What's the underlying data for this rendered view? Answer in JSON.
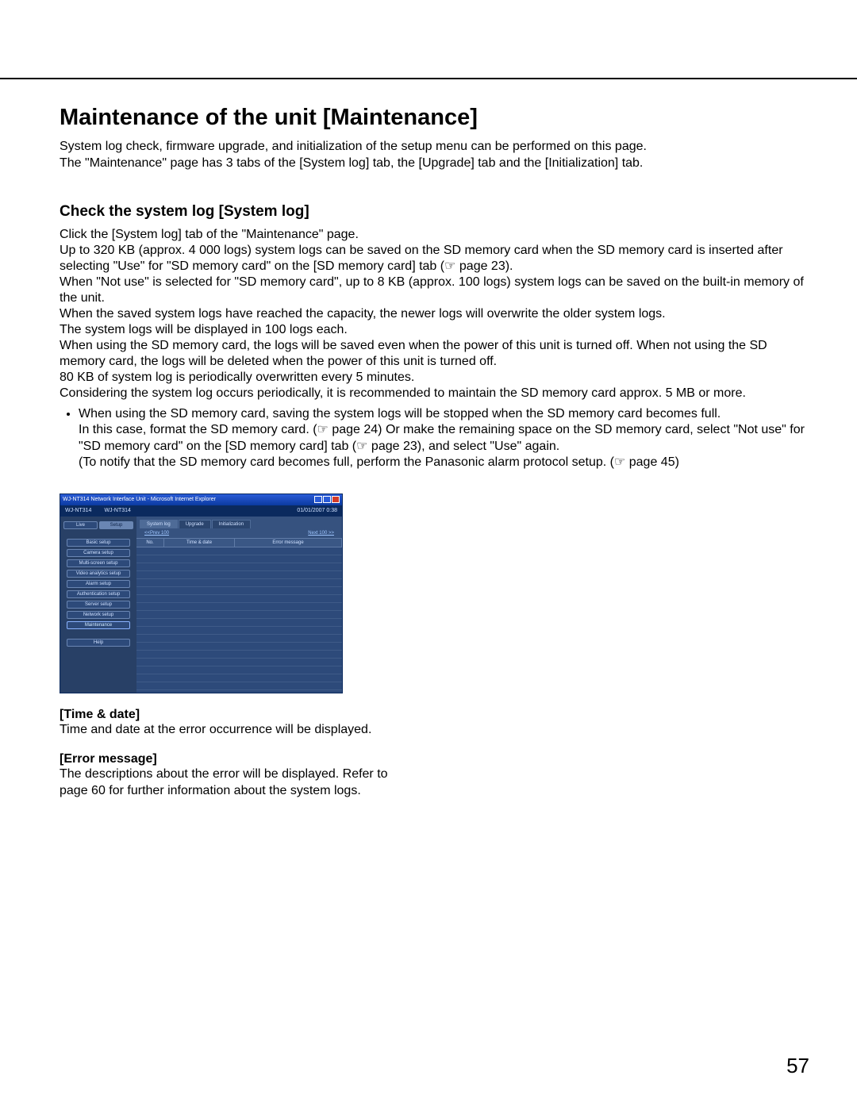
{
  "page_number": "57",
  "h1": "Maintenance of the unit [Maintenance]",
  "intro_1": "System log check, firmware upgrade, and initialization of the setup menu can be performed on this page.",
  "intro_2": "The \"Maintenance\" page has 3 tabs of the [System log] tab, the [Upgrade] tab and the [Initialization] tab.",
  "h2": "Check the system log [System log]",
  "body": {
    "p1": "Click the [System log] tab of the \"Maintenance\" page.",
    "p2": "Up to 320 KB (approx. 4 000 logs) system logs can be saved on the SD memory card when the SD memory card is inserted after selecting \"Use\" for \"SD memory card\" on the [SD memory card] tab (☞ page 23).",
    "p3": "When \"Not use\" is selected for \"SD memory card\", up to 8 KB (approx. 100 logs) system logs can be saved on the built-in memory of the unit.",
    "p4": "When the saved system logs have reached the capacity, the newer logs will overwrite the older system logs.",
    "p5": "The system logs will be displayed in 100 logs each.",
    "p6": "When using the SD memory card, the logs will be saved even when the power of this unit is turned off. When not using the SD memory card, the logs will be deleted when the power of this unit is turned off.",
    "p7": "80 KB of system log is periodically overwritten every 5 minutes.",
    "p8": "Considering the system log occurs periodically, it is recommended to maintain the SD memory card approx. 5 MB or more."
  },
  "bullet": {
    "b1": "When using the SD memory card, saving the system logs will be stopped when the SD memory card becomes full.",
    "b1a": "In this case, format the SD memory card. (☞ page 24) Or make the remaining space on the SD memory card, select \"Not use\" for \"SD memory card\" on the [SD memory card] tab (☞ page 23), and select \"Use\" again.",
    "b1b": "(To notify that the SD memory card becomes full, perform the Panasonic alarm protocol setup. (☞ page 45)"
  },
  "fields": {
    "time_label": "[Time & date]",
    "time_desc": "Time and date at the error occurrence will be displayed.",
    "err_label": "[Error message]",
    "err_desc": "The descriptions about the error will be displayed. Refer to page 60 for further information about the system logs."
  },
  "shot": {
    "titlebar": "WJ-NT314 Network Interface Unit  -  Microsoft Internet Explorer",
    "brand_left": "WJ-NT314",
    "brand_mid": "WJ-NT314",
    "brand_right": "01/01/2007  0:38",
    "top_tabs": {
      "live": "Live",
      "setup": "Setup"
    },
    "side_buttons": [
      "Basic setup",
      "Camera setup",
      "Multi-screen setup",
      "Video analytics setup",
      "Alarm setup",
      "Authentication setup",
      "Server setup",
      "Network setup",
      "Maintenance"
    ],
    "help": "Help",
    "content_tabs": {
      "syslog": "System log",
      "upgrade": "Upgrade",
      "init": "Initialization"
    },
    "pager_prev": "<<Prev 100",
    "pager_next": "Next 100 >>",
    "grid": {
      "no": "No.",
      "time": "Time & date",
      "err": "Error message"
    }
  }
}
